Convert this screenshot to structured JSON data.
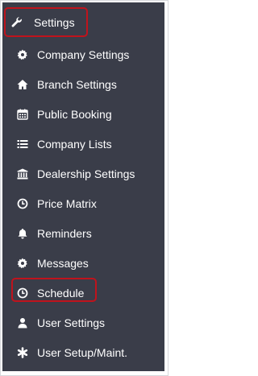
{
  "menu": {
    "header": {
      "label": "Settings",
      "icon": "wrench-icon"
    },
    "items": [
      {
        "id": "company-settings",
        "label": "Company Settings",
        "icon": "gear-icon"
      },
      {
        "id": "branch-settings",
        "label": "Branch Settings",
        "icon": "home-icon"
      },
      {
        "id": "public-booking",
        "label": "Public Booking",
        "icon": "calendar-icon"
      },
      {
        "id": "company-lists",
        "label": "Company Lists",
        "icon": "list-icon"
      },
      {
        "id": "dealership-settings",
        "label": "Dealership Settings",
        "icon": "bank-icon"
      },
      {
        "id": "price-matrix",
        "label": "Price Matrix",
        "icon": "clock-icon"
      },
      {
        "id": "reminders",
        "label": "Reminders",
        "icon": "bell-icon"
      },
      {
        "id": "messages",
        "label": "Messages",
        "icon": "gear-icon"
      },
      {
        "id": "schedule",
        "label": "Schedule",
        "icon": "clock-icon"
      },
      {
        "id": "user-settings",
        "label": "User Settings",
        "icon": "user-icon"
      },
      {
        "id": "user-setup-maint",
        "label": "User Setup/Maint.",
        "icon": "asterisk-icon"
      }
    ]
  },
  "colors": {
    "sidebar_bg": "#3a3d49",
    "text": "#ffffff",
    "highlight_border": "#c0131c"
  }
}
